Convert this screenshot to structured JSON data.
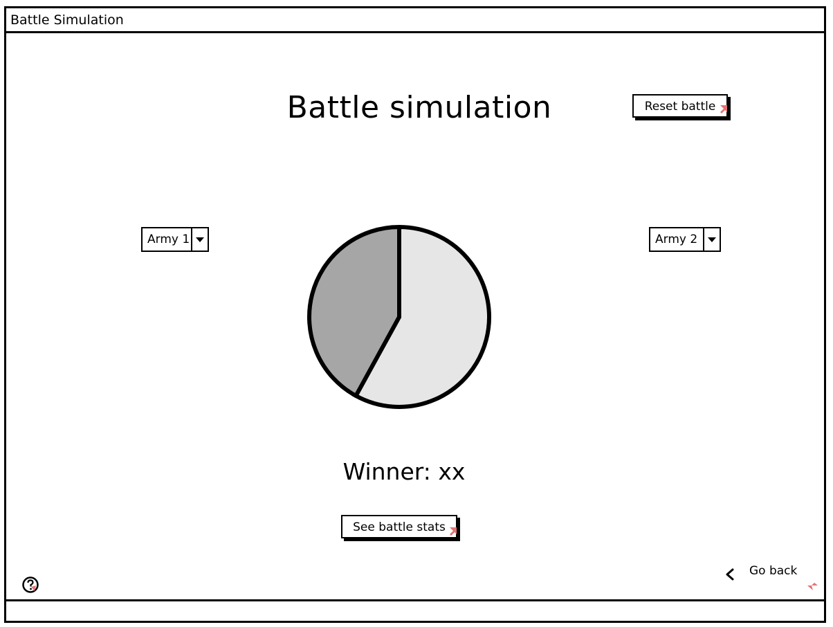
{
  "window": {
    "title": "Battle Simulation"
  },
  "main": {
    "heading": "Battle simulation",
    "reset_button_label": "Reset battle",
    "army_selectors": [
      {
        "value": "Army 1"
      },
      {
        "value": "Army 2"
      }
    ],
    "winner_text": "Winner: xx",
    "stats_button_label": "See battle stats",
    "go_back_label": "Go back"
  },
  "chart_data": {
    "type": "pie",
    "values": [
      58,
      42
    ],
    "colors": [
      "#e6e6e6",
      "#a6a6a6"
    ]
  },
  "icons": {
    "help": "help-icon",
    "back": "chevron-left-icon",
    "cursor": "cursor-icon"
  }
}
